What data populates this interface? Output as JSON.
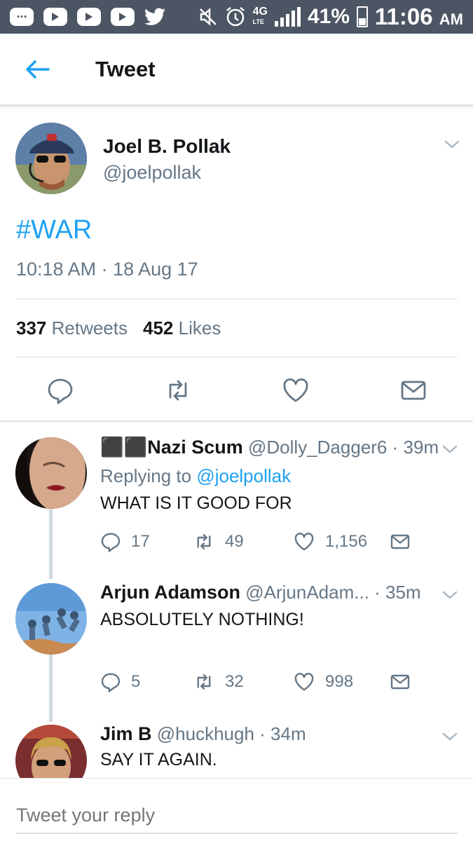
{
  "status_bar": {
    "network": "4G",
    "network_sub": "LTE",
    "battery": "41%",
    "time": "11:06",
    "ampm": "AM"
  },
  "header": {
    "title": "Tweet"
  },
  "tweet": {
    "name": "Joel B. Pollak",
    "handle": "@joelpollak",
    "text": "#WAR",
    "timestamp": "10:18 AM · 18 Aug 17",
    "retweets_count": "337",
    "retweets_label": "Retweets",
    "likes_count": "452",
    "likes_label": "Likes"
  },
  "replies": [
    {
      "name": "⬛⬛Nazi Scum",
      "handle": "@Dolly_Dagger6",
      "time": "· 39m",
      "replying_prefix": "Replying to",
      "replying_to": "@joelpollak",
      "text": "WHAT IS IT GOOD FOR",
      "replies": "17",
      "retweets": "49",
      "likes": "1,156"
    },
    {
      "name": "Arjun Adamson",
      "handle": "@ArjunAdam...",
      "time": "· 35m",
      "text": "ABSOLUTELY NOTHING!",
      "replies": "5",
      "retweets": "32",
      "likes": "998"
    },
    {
      "name": "Jim B",
      "handle": "@huckhugh",
      "time": "· 34m",
      "text": "SAY IT AGAIN."
    }
  ],
  "composer": {
    "placeholder": "Tweet your reply"
  },
  "colors": {
    "accent": "#1da1f2",
    "status_bar": "#4c5563",
    "muted": "#657786"
  }
}
